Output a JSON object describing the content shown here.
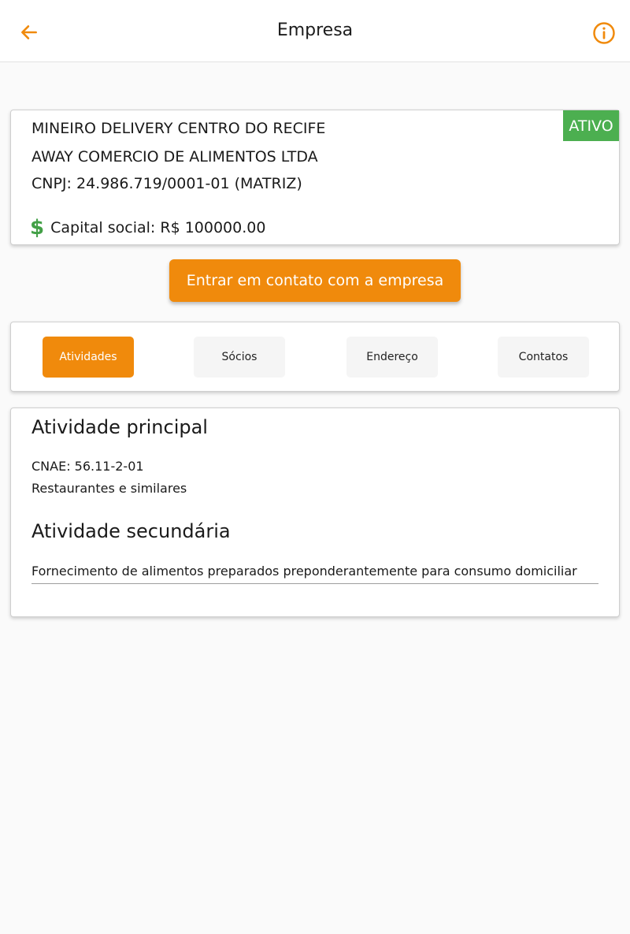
{
  "header": {
    "title": "Empresa",
    "back_icon": "arrow-left-icon",
    "info_icon": "info-circle-icon",
    "accent_color": "#f08a0c"
  },
  "company": {
    "name_line1": "MINEIRO DELIVERY CENTRO DO RECIFE",
    "name_line2": "AWAY COMERCIO DE ALIMENTOS LTDA",
    "cnpj": "CNPJ: 24.986.719/0001-01 (MATRIZ)",
    "capital_icon": "dollar-icon",
    "capital": "Capital social: R$ 100000.00",
    "status": "ATIVO",
    "status_color": "#4caf50"
  },
  "contact_button": {
    "label": "Entrar em contato com a empresa"
  },
  "tabs": [
    {
      "label": "Atividades",
      "active": true
    },
    {
      "label": "Sócios",
      "active": false
    },
    {
      "label": "Endereço",
      "active": false
    },
    {
      "label": "Contatos",
      "active": false
    }
  ],
  "activities": {
    "main_title": "Atividade principal",
    "cnae": "CNAE: 56.11-2-01",
    "main_description": "Restaurantes e similares",
    "secondary_title": "Atividade secundária",
    "secondary_description": "Fornecimento de alimentos preparados preponderantemente para consumo domiciliar"
  }
}
